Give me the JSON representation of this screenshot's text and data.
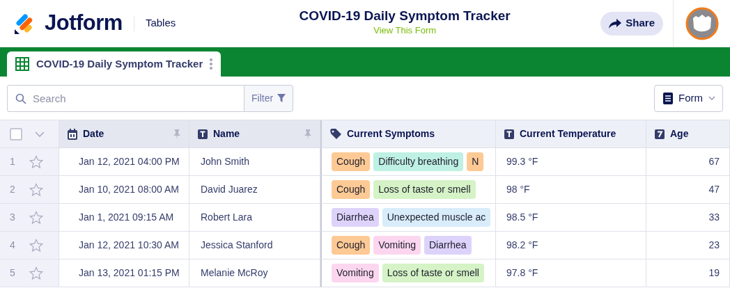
{
  "header": {
    "brand": "Jotform",
    "section": "Tables",
    "title": "COVID-19 Daily Symptom Tracker",
    "subtitle": "View This Form",
    "share": "Share"
  },
  "tab": {
    "label": "COVID-19 Daily Symptom Tracker",
    "selected": true
  },
  "toolbar": {
    "search": {
      "placeholder": "Search"
    },
    "filter": "Filter",
    "view": "Form"
  },
  "table": {
    "select_all": {
      "checked": false
    },
    "columns": [
      {
        "label": "Date",
        "kind": "date",
        "pinned": true
      },
      {
        "label": "Name",
        "kind": "text",
        "pinned": true
      },
      {
        "label": "Current Symptoms",
        "kind": "tags",
        "pinned": false
      },
      {
        "label": "Current Temperature",
        "kind": "text",
        "pinned": false
      },
      {
        "label": "Age",
        "kind": "number",
        "pinned": false
      }
    ],
    "rows": [
      {
        "number": "1",
        "starred": false,
        "date": "Jan 12, 2021 04:00 PM",
        "name": "John Smith",
        "symptoms": [
          {
            "label": "Cough",
            "color": "#fdc994"
          },
          {
            "label": "Difficulty breathing",
            "color": "#bff0e4"
          },
          {
            "label": "N",
            "color": "#fdc994"
          }
        ],
        "temperature": "99.3 °F",
        "age": "67"
      },
      {
        "number": "2",
        "starred": false,
        "date": "Jan 10, 2021 08:00 AM",
        "name": "David Juarez",
        "symptoms": [
          {
            "label": "Cough",
            "color": "#fdc994"
          },
          {
            "label": "Loss of taste or smell",
            "color": "#d5f3c6"
          }
        ],
        "temperature": "98 °F",
        "age": "47"
      },
      {
        "number": "3",
        "starred": false,
        "date": "Jan 1, 2021 09:15 AM",
        "name": "Robert Lara",
        "symptoms": [
          {
            "label": "Diarrhea",
            "color": "#ddd3fa"
          },
          {
            "label": "Unexpected muscle ac",
            "color": "#d8ecfa"
          }
        ],
        "temperature": "98.5 °F",
        "age": "33"
      },
      {
        "number": "4",
        "starred": false,
        "date": "Jan 12, 2021 10:30 AM",
        "name": "Jessica Stanford",
        "symptoms": [
          {
            "label": "Cough",
            "color": "#fdc994"
          },
          {
            "label": "Vomiting",
            "color": "#fcd6ef"
          },
          {
            "label": "Diarrhea",
            "color": "#ddd3fa"
          }
        ],
        "temperature": "98.2 °F",
        "age": "23"
      },
      {
        "number": "5",
        "starred": false,
        "date": "Jan 13, 2021 01:15 PM",
        "name": "Melanie McRoy",
        "symptoms": [
          {
            "label": "Vomiting",
            "color": "#fcd6ef"
          },
          {
            "label": "Loss of taste or smell",
            "color": "#d5f3c6"
          }
        ],
        "temperature": "97.8 °F",
        "age": "19"
      }
    ]
  }
}
